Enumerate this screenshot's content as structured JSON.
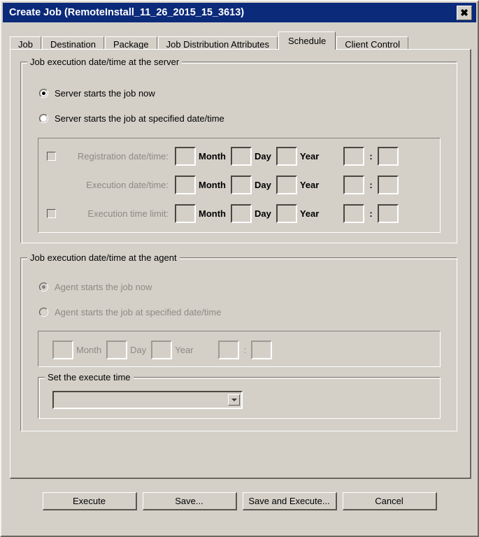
{
  "window": {
    "title": "Create Job (RemoteInstall_11_26_2015_15_3613)",
    "close_label": "✕",
    "titlebar_color": "#0b2a7a",
    "face_color": "#d4d0c8"
  },
  "tabs": [
    {
      "label": "Job",
      "active": false
    },
    {
      "label": "Destination",
      "active": false
    },
    {
      "label": "Package",
      "active": false
    },
    {
      "label": "Job Distribution Attributes",
      "active": false
    },
    {
      "label": "Schedule",
      "active": true
    },
    {
      "label": "Client Control",
      "active": false
    }
  ],
  "server_group": {
    "title": "Job execution date/time at the server",
    "radios": [
      {
        "label": "Server starts the job now",
        "checked": true,
        "disabled": false
      },
      {
        "label": "Server starts the job at specified date/time",
        "checked": false,
        "disabled": false
      }
    ],
    "rows": [
      {
        "has_checkbox": true,
        "checkbox_checked": false,
        "label": "Registration date/time:",
        "month_unit": "Month",
        "day_unit": "Day",
        "year_unit": "Year",
        "time_separator": ":",
        "month_value": "",
        "day_value": "",
        "year_value": "",
        "hour_value": "",
        "minute_value": ""
      },
      {
        "has_checkbox": false,
        "checkbox_checked": false,
        "label": "Execution date/time:",
        "month_unit": "Month",
        "day_unit": "Day",
        "year_unit": "Year",
        "time_separator": ":",
        "month_value": "",
        "day_value": "",
        "year_value": "",
        "hour_value": "",
        "minute_value": ""
      },
      {
        "has_checkbox": true,
        "checkbox_checked": false,
        "label": "Execution time limit:",
        "month_unit": "Month",
        "day_unit": "Day",
        "year_unit": "Year",
        "time_separator": ":",
        "month_value": "",
        "day_value": "",
        "year_value": "",
        "hour_value": "",
        "minute_value": ""
      }
    ]
  },
  "agent_group": {
    "title": "Job execution date/time at the agent",
    "radios": [
      {
        "label": "Agent starts the job now",
        "checked": true,
        "disabled": true
      },
      {
        "label": "Agent starts the job at specified date/time",
        "checked": false,
        "disabled": true
      }
    ],
    "row": {
      "month_unit": "Month",
      "day_unit": "Day",
      "year_unit": "Year",
      "time_separator": ":",
      "month_value": "",
      "day_value": "",
      "year_value": "",
      "hour_value": "",
      "minute_value": ""
    },
    "execute_time_group": {
      "title": "Set the execute time",
      "combo_value": "",
      "combo_arrow": "chevron-down-icon"
    }
  },
  "buttons": [
    {
      "label": "Execute"
    },
    {
      "label": "Save..."
    },
    {
      "label": "Save and Execute..."
    },
    {
      "label": "Cancel"
    }
  ]
}
